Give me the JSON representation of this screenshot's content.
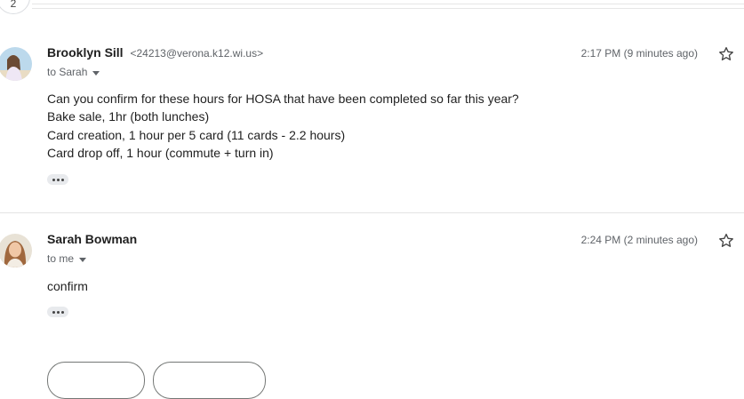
{
  "thread": {
    "collapsed_count": "2"
  },
  "messages": [
    {
      "sender_name": "Brooklyn Sill",
      "sender_email": "<24213@verona.k12.wi.us>",
      "to": "to Sarah",
      "timestamp": "2:17 PM (9 minutes ago)",
      "body": [
        "Can you confirm for these hours for HOSA that have been completed so far this year?",
        "Bake sale, 1hr (both lunches)",
        "Card creation, 1 hour per 5 card (11 cards - 2.2 hours)",
        "Card drop off, 1 hour (commute + turn in)"
      ]
    },
    {
      "sender_name": "Sarah Bowman",
      "to": "to me",
      "timestamp": "2:24 PM (2 minutes ago)",
      "body": [
        "confirm"
      ]
    }
  ],
  "icons": {
    "star": "star-icon",
    "caret": "chevron-down-icon",
    "more": "more-horiz-icon"
  },
  "colors": {
    "text": "#1f1f1f",
    "secondary": "#5f6368",
    "divider": "#e3e3e3",
    "chip_bg": "#e8eaed"
  }
}
